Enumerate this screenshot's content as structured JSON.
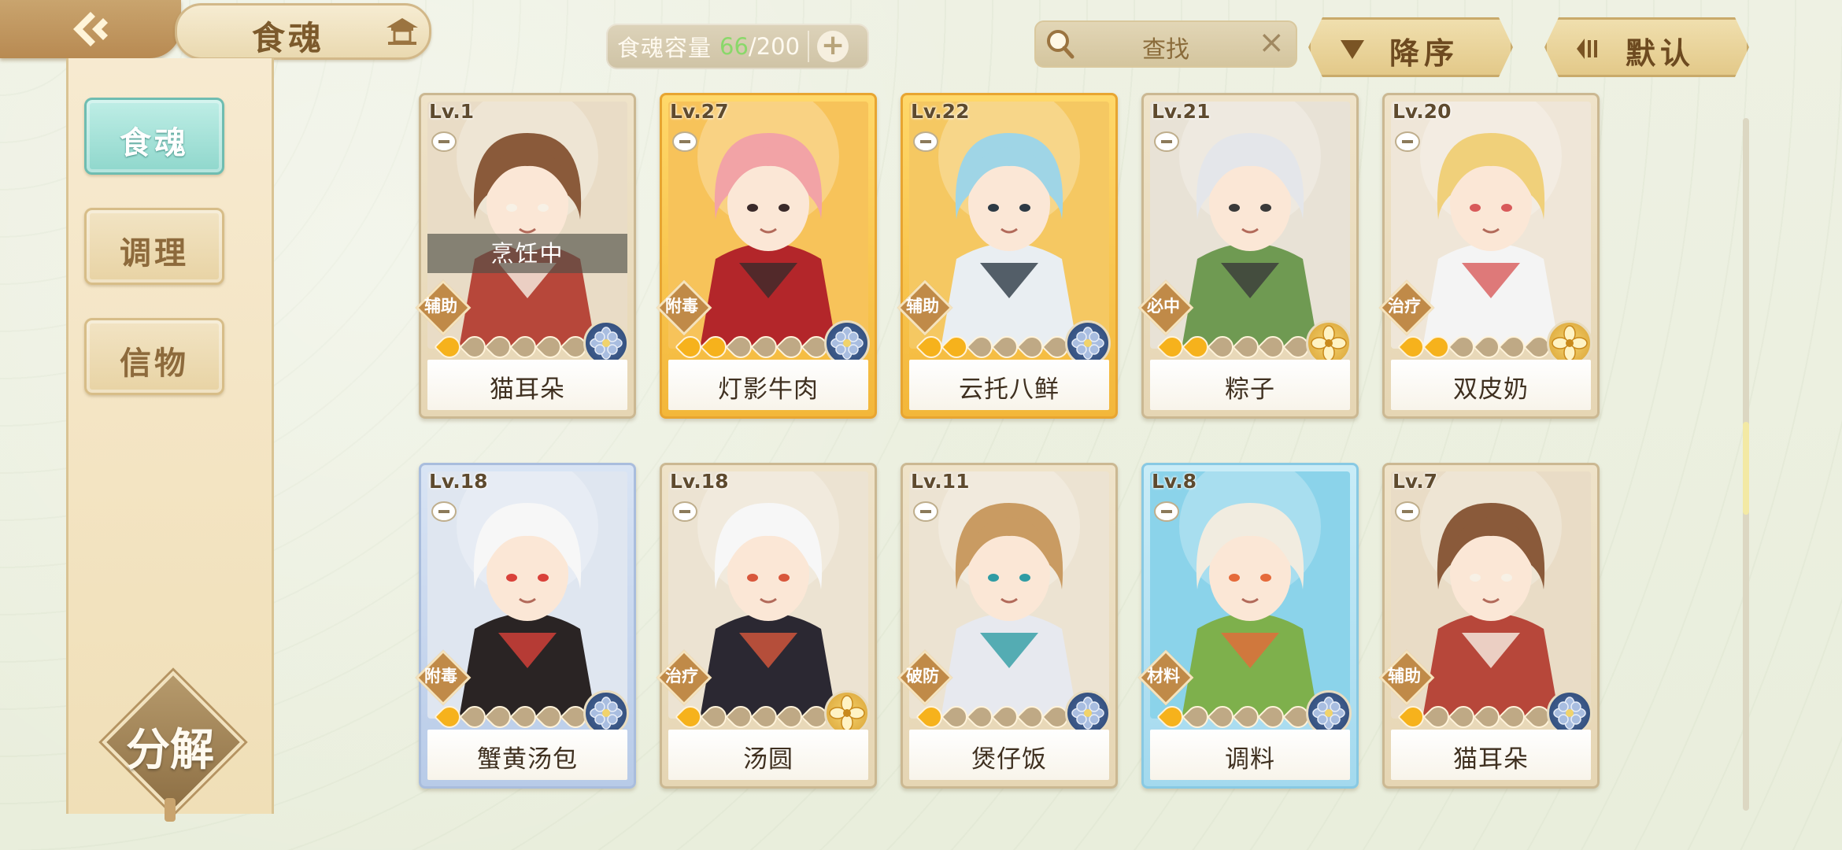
{
  "header": {
    "title": "食魂",
    "capacity_label": "食魂容量",
    "capacity_current": "66",
    "capacity_sep": "/",
    "capacity_max": "200",
    "add_symbol": "+",
    "search_label": "查找",
    "search_clear": "×",
    "sort_order_label": "降序",
    "sort_mode_label": "默认"
  },
  "sidebar": {
    "tabs": [
      {
        "label": "食魂",
        "active": true
      },
      {
        "label": "调理",
        "active": false
      },
      {
        "label": "信物",
        "active": false
      }
    ],
    "decompose_label": "分解"
  },
  "cards": [
    {
      "level": "Lv.1",
      "name": "猫耳朵",
      "role": "辅助",
      "stars": 1,
      "rarity": "normal",
      "element": "blue",
      "status": "烹饪中",
      "portrait": "brown-hair-cat-ears"
    },
    {
      "level": "Lv.27",
      "name": "灯影牛肉",
      "role": "附毒",
      "stars": 2,
      "rarity": "gold",
      "element": "blue",
      "status": "",
      "portrait": "pink-hair-horns"
    },
    {
      "level": "Lv.22",
      "name": "云托八鲜",
      "role": "辅助",
      "stars": 2,
      "rarity": "gold",
      "element": "blue",
      "status": "",
      "portrait": "blue-long-hair"
    },
    {
      "level": "Lv.21",
      "name": "粽子",
      "role": "必中",
      "stars": 2,
      "rarity": "normal",
      "element": "gold",
      "status": "",
      "portrait": "white-hair-green-robe"
    },
    {
      "level": "Lv.20",
      "name": "双皮奶",
      "role": "治疗",
      "stars": 2,
      "rarity": "normal",
      "element": "gold",
      "status": "",
      "portrait": "straw-hat-white-hair"
    },
    {
      "level": "Lv.18",
      "name": "蟹黄汤包",
      "role": "附毒",
      "stars": 1,
      "rarity": "blue",
      "element": "blue",
      "status": "",
      "portrait": "white-hood-black-hair"
    },
    {
      "level": "Lv.18",
      "name": "汤圆",
      "role": "治疗",
      "stars": 1,
      "rarity": "normal",
      "element": "gold",
      "status": "",
      "portrait": "white-hat-black-hair"
    },
    {
      "level": "Lv.11",
      "name": "煲仔饭",
      "role": "破防",
      "stars": 1,
      "rarity": "normal",
      "element": "blue",
      "status": "",
      "portrait": "bamboo-hat-silver-hair"
    },
    {
      "level": "Lv.8",
      "name": "调料",
      "role": "材料",
      "stars": 1,
      "rarity": "cyan",
      "element": "blue",
      "status": "",
      "portrait": "chibi-green-outfit"
    },
    {
      "level": "Lv.7",
      "name": "猫耳朵",
      "role": "辅助",
      "stars": 1,
      "rarity": "normal",
      "element": "blue",
      "status": "",
      "portrait": "brown-hair-cat-ears"
    }
  ],
  "colors": {
    "accent_gold": "#e3c989",
    "active_tab": "#8fd7cc",
    "capacity_current": "#8ad86a"
  }
}
